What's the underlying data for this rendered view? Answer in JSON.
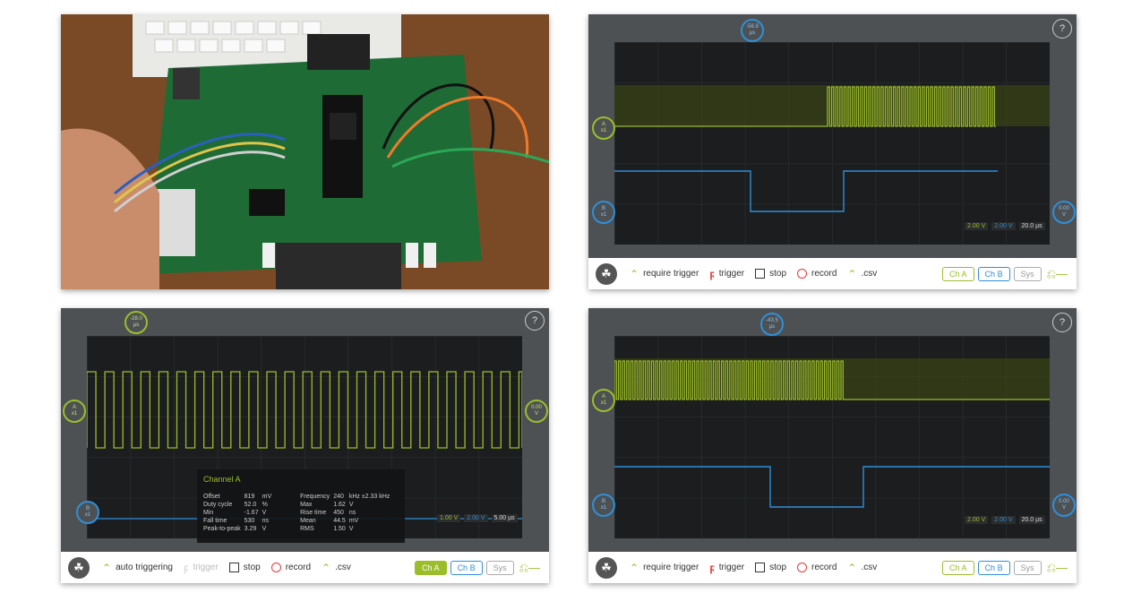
{
  "help_label": "?",
  "photo": {
    "icon": "circuit-board-photo"
  },
  "bar": {
    "require_trigger": "require trigger",
    "auto_triggering": "auto triggering",
    "trigger": "trigger",
    "stop": "stop",
    "record": "record",
    "csv": ".csv",
    "ch_a": "Ch A",
    "ch_b": "Ch B",
    "sys": "Sys",
    "usb_icon": "usb-icon"
  },
  "scope_tr": {
    "trigger_time": "-56.9",
    "time_unit": "µs",
    "marker_a": "A",
    "marker_b": "B",
    "marker_sub": "x1",
    "offset_val": "0.00",
    "offset_unit": "V",
    "scale_a": "2.00 V",
    "scale_b": "2.00 V",
    "scale_t": "20.0 µs"
  },
  "scope_bl": {
    "trigger_time": "-28.0",
    "time_unit": "µs",
    "marker_a": "A",
    "marker_b": "B",
    "marker_sub": "x1",
    "offset_val": "0.00",
    "offset_unit": "V",
    "scale_a": "1.00 V",
    "scale_b": "2.00 V",
    "scale_t": "5.00 µs",
    "measurements": {
      "title": "Channel A",
      "rows": [
        {
          "l1": "Offset",
          "v1": "819",
          "u1": "mV",
          "l2": "Frequency",
          "v2": "240",
          "u2": "kHz ±2.33  kHz"
        },
        {
          "l1": "Duty cycle",
          "v1": "52.0",
          "u1": "%",
          "l2": "Max",
          "v2": "1.62",
          "u2": "V"
        },
        {
          "l1": "Min",
          "v1": "-1.67",
          "u1": "V",
          "l2": "Rise time",
          "v2": "450",
          "u2": "ns"
        },
        {
          "l1": "Fall time",
          "v1": "530",
          "u1": "ns",
          "l2": "Mean",
          "v2": "44.5",
          "u2": "mV"
        },
        {
          "l1": "Peak-to-peak",
          "v1": "3.29",
          "u1": "V",
          "l2": "RMS",
          "v2": "1.50",
          "u2": "V"
        }
      ]
    }
  },
  "scope_br": {
    "trigger_time": "-43.5",
    "time_unit": "µs",
    "marker_a": "A",
    "marker_b": "B",
    "marker_sub": "x1",
    "offset_val": "0.00",
    "offset_unit": "V",
    "scale_a": "2.00 V",
    "scale_b": "2.00 V",
    "scale_t": "20.0 µs"
  },
  "colors": {
    "ch_a": "#9cbd2a",
    "ch_b": "#2f8fd8",
    "trigger": "#e33333"
  }
}
